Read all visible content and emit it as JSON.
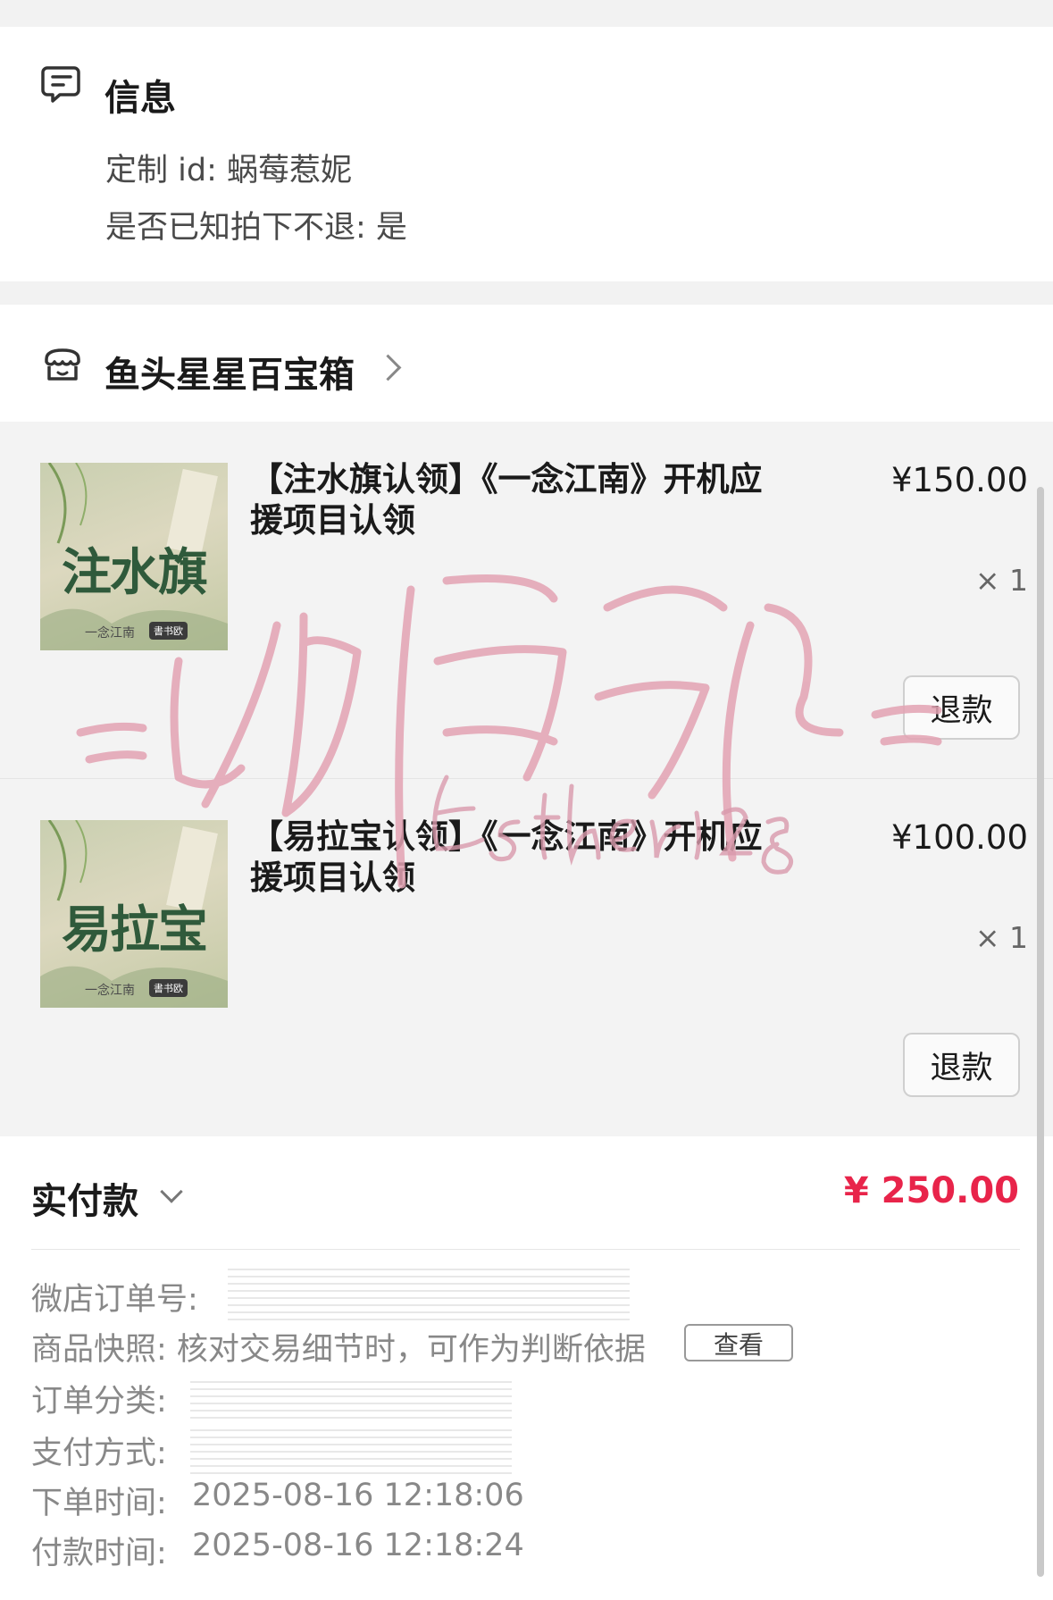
{
  "info": {
    "title": "信息",
    "custom_id": "定制 id: 蜗莓惹妮",
    "no_refund_ack": "是否已知拍下不退: 是"
  },
  "shop": {
    "name": "鱼头星星百宝箱"
  },
  "items": [
    {
      "thumb_text": "注水旗",
      "thumb_sub": "一念江南",
      "thumb_tag": "書书欧",
      "title": "【注水旗认领】《一念江南》开机应援项目认领",
      "price": "¥150.00",
      "qty": "× 1",
      "refund_label": "退款"
    },
    {
      "thumb_text": "易拉宝",
      "thumb_sub": "一念江南",
      "thumb_tag": "書书欧",
      "title": "【易拉宝认领】《一念江南》开机应援项目认领",
      "price": "¥100.00",
      "qty": "× 1",
      "refund_label": "退款"
    }
  ],
  "summary": {
    "paid_label": "实付款",
    "paid_amount": "¥ 250.00",
    "order_no_label": "微店订单号:",
    "snapshot_text": "商品快照: 核对交易细节时，可作为判断依据",
    "view_label": "查看",
    "category_label": "订单分类:",
    "payment_label": "支付方式:",
    "order_time_label": "下单时间:",
    "order_time": "2025-08-16 12:18:06",
    "pay_time_label": "付款时间:",
    "pay_time": "2025-08-16 12:18:24"
  },
  "watermark": {
    "text": "蜗莓惹妮",
    "signature": "Esther1218"
  },
  "colors": {
    "accent": "#e8244a",
    "watermark": "#e8a4b4"
  },
  "icons": {
    "info": "message-note-icon",
    "shop": "storefront-icon"
  }
}
